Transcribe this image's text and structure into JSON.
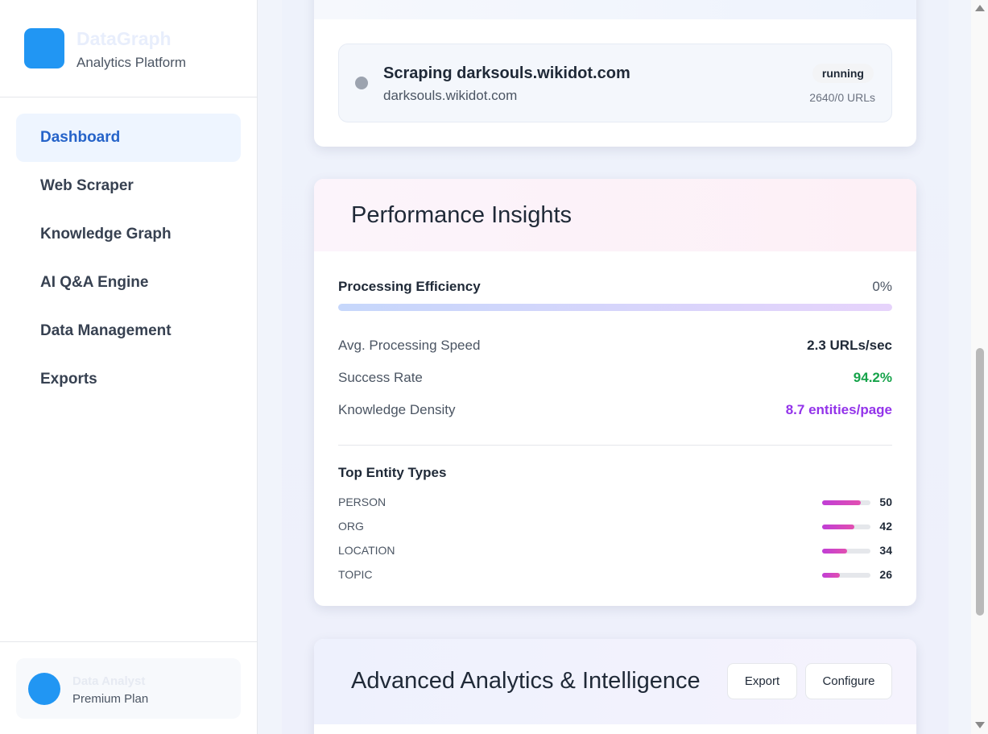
{
  "brand": {
    "name": "DataGraph",
    "subtitle": "Analytics Platform"
  },
  "nav": {
    "items": [
      {
        "label": "Dashboard",
        "active": true
      },
      {
        "label": "Web Scraper"
      },
      {
        "label": "Knowledge Graph"
      },
      {
        "label": "AI Q&A Engine"
      },
      {
        "label": "Data Management"
      },
      {
        "label": "Exports"
      }
    ]
  },
  "user": {
    "name": "Data Analyst",
    "plan": "Premium Plan"
  },
  "job": {
    "title": "Scraping darksouls.wikidot.com",
    "domain": "darksouls.wikidot.com",
    "status": "running",
    "count": "2640/0 URLs"
  },
  "insights": {
    "title": "Performance Insights",
    "efficiency_label": "Processing Efficiency",
    "efficiency_value": "0%",
    "efficiency_fraction": 0,
    "metrics": [
      {
        "label": "Avg. Processing Speed",
        "value": "2.3 URLs/sec",
        "color": "#1f2937"
      },
      {
        "label": "Success Rate",
        "value": "94.2%",
        "color": "#16a34a"
      },
      {
        "label": "Knowledge Density",
        "value": "8.7 entities/page",
        "color": "#9333ea"
      }
    ],
    "entity_title": "Top Entity Types",
    "entities": [
      {
        "label": "PERSON",
        "count": "50",
        "fraction": 0.8
      },
      {
        "label": "ORG",
        "count": "42",
        "fraction": 0.67
      },
      {
        "label": "LOCATION",
        "count": "34",
        "fraction": 0.52
      },
      {
        "label": "TOPIC",
        "count": "26",
        "fraction": 0.37
      }
    ]
  },
  "analytics": {
    "title": "Advanced Analytics & Intelligence",
    "export_label": "Export",
    "configure_label": "Configure"
  },
  "colors": {
    "accent": "#2196f3",
    "active_nav": "#2563c9",
    "success": "#16a34a",
    "purple": "#9333ea"
  }
}
